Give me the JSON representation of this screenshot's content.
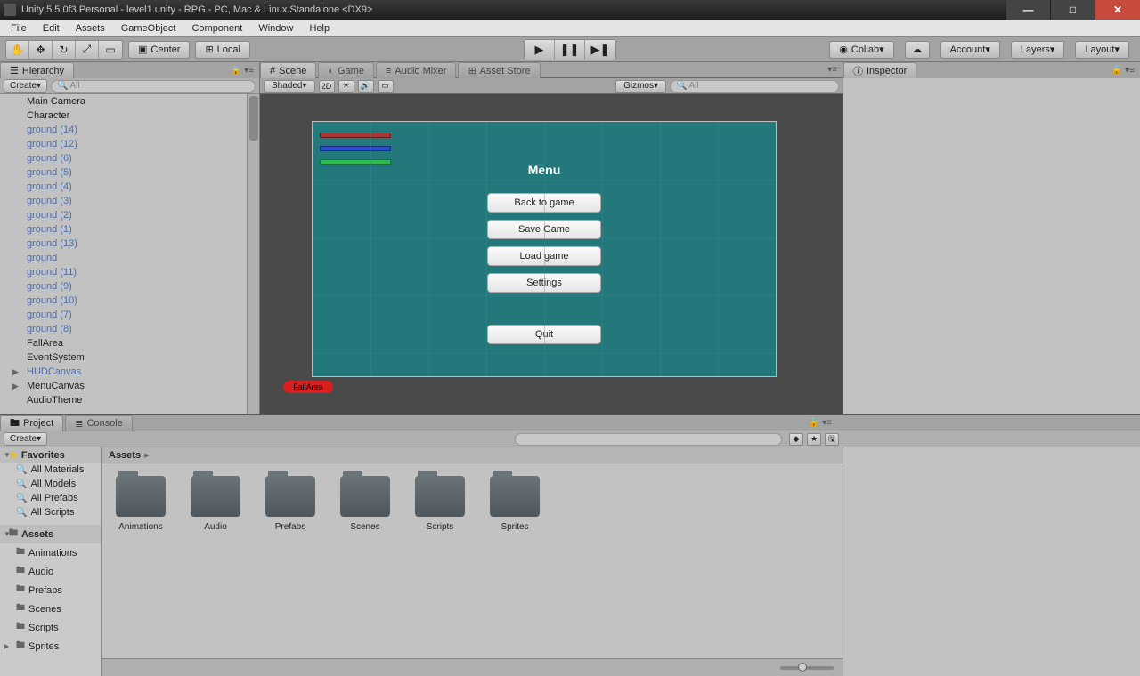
{
  "window": {
    "title": "Unity 5.5.0f3 Personal - level1.unity - RPG - PC, Mac & Linux Standalone <DX9>"
  },
  "menubar": [
    "File",
    "Edit",
    "Assets",
    "GameObject",
    "Component",
    "Window",
    "Help"
  ],
  "toolbar": {
    "center_pivot": "Center",
    "local_global": "Local",
    "collab": "Collab",
    "account": "Account",
    "layers": "Layers",
    "layout": "Layout"
  },
  "hierarchy": {
    "title": "Hierarchy",
    "create": "Create",
    "search_placeholder": "All",
    "items": [
      {
        "label": "Main Camera",
        "blue": false
      },
      {
        "label": "Character",
        "blue": false
      },
      {
        "label": "ground (14)",
        "blue": true
      },
      {
        "label": "ground (12)",
        "blue": true
      },
      {
        "label": "ground (6)",
        "blue": true
      },
      {
        "label": "ground (5)",
        "blue": true
      },
      {
        "label": "ground (4)",
        "blue": true
      },
      {
        "label": "ground (3)",
        "blue": true
      },
      {
        "label": "ground (2)",
        "blue": true
      },
      {
        "label": "ground (1)",
        "blue": true
      },
      {
        "label": "ground (13)",
        "blue": true
      },
      {
        "label": "ground",
        "blue": true
      },
      {
        "label": "ground (11)",
        "blue": true
      },
      {
        "label": "ground (9)",
        "blue": true
      },
      {
        "label": "ground (10)",
        "blue": true
      },
      {
        "label": "ground (7)",
        "blue": true
      },
      {
        "label": "ground (8)",
        "blue": true
      },
      {
        "label": "FallArea",
        "blue": false
      },
      {
        "label": "EventSystem",
        "blue": false
      },
      {
        "label": "HUDCanvas",
        "blue": true,
        "arrow": true
      },
      {
        "label": "MenuCanvas",
        "blue": false,
        "arrow": true
      },
      {
        "label": "AudioTheme",
        "blue": false
      }
    ]
  },
  "scene_tabs": {
    "scene": "Scene",
    "game": "Game",
    "audio": "Audio Mixer",
    "store": "Asset Store"
  },
  "scene_toolbar": {
    "shading": "Shaded",
    "mode2d": "2D",
    "gizmos": "Gizmos",
    "search_placeholder": "All"
  },
  "game_menu": {
    "title": "Menu",
    "buttons": [
      "Back to game",
      "Save Game",
      "Load game",
      "Settings",
      "Quit"
    ]
  },
  "fallarea_label": "FallArea",
  "inspector": {
    "title": "Inspector"
  },
  "project": {
    "tab_project": "Project",
    "tab_console": "Console",
    "create": "Create",
    "favorites_hdr": "Favorites",
    "favorites": [
      "All Materials",
      "All Models",
      "All Prefabs",
      "All Scripts"
    ],
    "assets_hdr": "Assets",
    "tree": [
      "Animations",
      "Audio",
      "Prefabs",
      "Scenes",
      "Scripts",
      "Sprites"
    ],
    "breadcrumb": "Assets",
    "folders": [
      "Animations",
      "Audio",
      "Prefabs",
      "Scenes",
      "Scripts",
      "Sprites"
    ]
  }
}
